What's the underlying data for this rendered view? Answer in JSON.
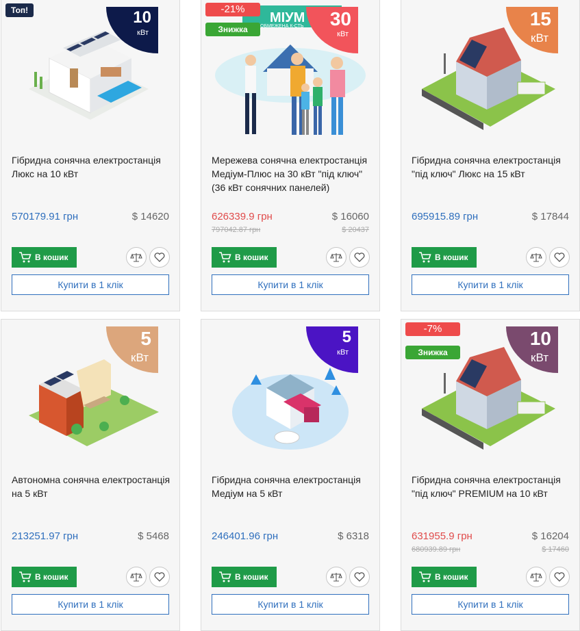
{
  "ui": {
    "cart_label": "В кошик",
    "oneclick_label": "Купити в 1 клік"
  },
  "products": [
    {
      "top_badge": "Топ!",
      "power_value": "10",
      "power_unit": "кВт",
      "power_color": "#0d1a4a",
      "title": "Гібридна сонячна електростанція Люкс на 10 кВт",
      "price": "570179.91 грн",
      "price_usd": "$ 14620"
    },
    {
      "discount": "-21%",
      "sale_label": "Знижка",
      "power_value": "30",
      "power_unit": "кВт",
      "power_color": "#f2545b",
      "promo_text": "МІУМ",
      "promo_sub": "ОБМЕЖЕНА К-СТЬ",
      "title": "Мережева сонячна електростанція Медіум-Плюс на 30 кВт \"під ключ\" (36 кВт сонячних панелей)",
      "price": "626339.9 грн",
      "price_usd": "$ 16060",
      "old_price": "797042.87 грн",
      "old_price_usd": "$ 20437"
    },
    {
      "power_value": "15",
      "power_unit": "кВт",
      "power_color": "#e8834a",
      "title": "Гібридна сонячна електростанція \"під ключ\" Люкс на 15 кВт",
      "price": "695915.89 грн",
      "price_usd": "$ 17844"
    },
    {
      "power_value": "5",
      "power_unit": "кВт",
      "power_color": "#dca67c",
      "title": "Автономна сонячна електростанція на 5 кВт",
      "price": "213251.97 грн",
      "price_usd": "$ 5468"
    },
    {
      "power_value": "5",
      "power_unit": "кВт",
      "power_color": "#4b14c4",
      "title": "Гібридна сонячна електростанція Медіум на 5 кВт",
      "price": "246401.96 грн",
      "price_usd": "$ 6318"
    },
    {
      "discount": "-7%",
      "sale_label": "Знижка",
      "power_value": "10",
      "power_unit": "кВт",
      "power_color": "#7a4a6e",
      "title": "Гібридна сонячна електростанція \"під ключ\" PREMIUM на 10 кВт",
      "price": "631955.9 грн",
      "price_usd": "$ 16204",
      "old_price": "680939.89 грн",
      "old_price_usd": "$ 17460"
    }
  ]
}
